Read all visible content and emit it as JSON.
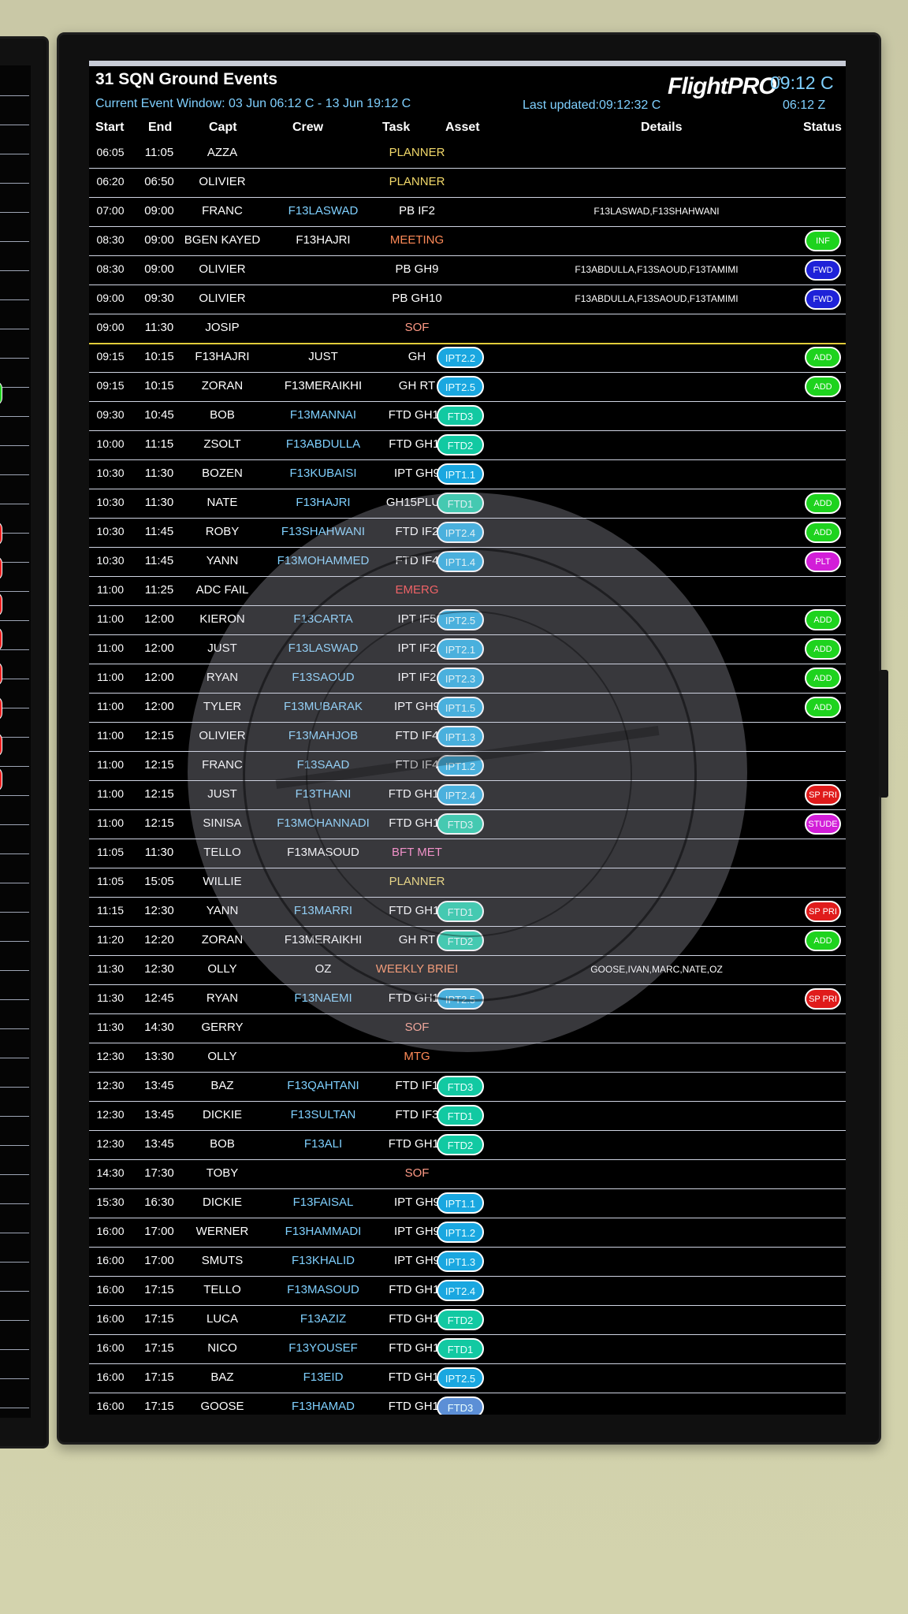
{
  "board": {
    "title": "31 SQN Ground Events",
    "event_window": "Current Event Window: 03 Jun 06:12 C - 13 Jun 19:12 C",
    "last_updated": "Last updated:09:12:32 C",
    "brand": "FlightPRO",
    "brand_sup": "°",
    "time_c": "09:12 C",
    "time_z": "06:12 Z"
  },
  "columns": [
    "Start",
    "End",
    "Capt",
    "Crew",
    "Task",
    "Asset",
    "Details",
    "Status"
  ],
  "rows": [
    {
      "start": "06:05",
      "end": "11:05",
      "capt": "AZZA",
      "crew": "",
      "task": "PLANNER",
      "task_color": "#f2d96a",
      "asset": "",
      "asset_color": "",
      "details": "",
      "status": "",
      "status_color": ""
    },
    {
      "start": "06:20",
      "end": "06:50",
      "capt": "OLIVIER",
      "crew": "",
      "task": "PLANNER",
      "task_color": "#f2d96a",
      "asset": "",
      "asset_color": "",
      "details": "",
      "status": "",
      "status_color": ""
    },
    {
      "start": "07:00",
      "end": "09:00",
      "capt": "FRANC",
      "crew": "F13LASWAD",
      "task": "PB IF2",
      "task_color": "#ffffff",
      "asset": "",
      "asset_color": "",
      "details": "F13LASWAD,F13SHAHWANI",
      "status": "",
      "status_color": ""
    },
    {
      "start": "08:30",
      "end": "09:00",
      "capt": "BGEN KAYED",
      "crew": "F13HAJRI",
      "crew_white": true,
      "task": "MEETING",
      "task_color": "#ff8a57",
      "asset": "",
      "asset_color": "",
      "details": "",
      "status": "INF",
      "status_color": "#1ed31e"
    },
    {
      "start": "08:30",
      "end": "09:00",
      "capt": "OLIVIER",
      "crew": "",
      "task": "PB GH9",
      "task_color": "#ffffff",
      "asset": "",
      "asset_color": "",
      "details": "F13ABDULLA,F13SAOUD,F13TAMIMI",
      "status": "FWD",
      "status_color": "#1e22d8"
    },
    {
      "start": "09:00",
      "end": "09:30",
      "capt": "OLIVIER",
      "crew": "",
      "task": "PB GH10",
      "task_color": "#ffffff",
      "asset": "",
      "asset_color": "",
      "details": "F13ABDULLA,F13SAOUD,F13TAMIMI",
      "status": "FWD",
      "status_color": "#1e22d8"
    },
    {
      "start": "09:00",
      "end": "11:30",
      "capt": "JOSIP",
      "crew": "",
      "task": "SOF",
      "task_color": "#ff9a86",
      "asset": "",
      "asset_color": "",
      "details": "",
      "status": "",
      "status_color": "",
      "sep": true
    },
    {
      "start": "09:15",
      "end": "10:15",
      "capt": "F13HAJRI",
      "crew": "JUST",
      "crew_white": true,
      "task": "GH",
      "task_color": "#ffffff",
      "asset": "IPT2.2",
      "asset_color": "#1aa7e0",
      "details": "",
      "status": "ADD",
      "status_color": "#1ed31e"
    },
    {
      "start": "09:15",
      "end": "10:15",
      "capt": "ZORAN",
      "crew": "F13MERAIKHI",
      "crew_white": true,
      "task": "GH RT",
      "task_color": "#ffffff",
      "asset": "IPT2.5",
      "asset_color": "#1aa7e0",
      "details": "",
      "status": "ADD",
      "status_color": "#1ed31e"
    },
    {
      "start": "09:30",
      "end": "10:45",
      "capt": "BOB",
      "crew": "F13MANNAI",
      "task": "FTD GH12",
      "task_color": "#ffffff",
      "asset": "FTD3",
      "asset_color": "#12c9a2",
      "details": "",
      "status": "",
      "status_color": ""
    },
    {
      "start": "10:00",
      "end": "11:15",
      "capt": "ZSOLT",
      "crew": "F13ABDULLA",
      "task": "FTD GH11",
      "task_color": "#ffffff",
      "asset": "FTD2",
      "asset_color": "#12c9a2",
      "details": "",
      "status": "",
      "status_color": ""
    },
    {
      "start": "10:30",
      "end": "11:30",
      "capt": "BOZEN",
      "crew": "F13KUBAISI",
      "task": "IPT GH9",
      "task_color": "#ffffff",
      "asset": "IPT1.1",
      "asset_color": "#1aa7e0",
      "details": "",
      "status": "",
      "status_color": ""
    },
    {
      "start": "10:30",
      "end": "11:30",
      "capt": "NATE",
      "crew": "F13HAJRI",
      "task": "GH15PLUS",
      "task_color": "#ffffff",
      "asset": "FTD1",
      "asset_color": "#12c9a2",
      "details": "",
      "status": "ADD",
      "status_color": "#1ed31e"
    },
    {
      "start": "10:30",
      "end": "11:45",
      "capt": "ROBY",
      "crew": "F13SHAHWANI",
      "task": "FTD IF2",
      "task_color": "#ffffff",
      "asset": "IPT2.4",
      "asset_color": "#1aa7e0",
      "details": "",
      "status": "ADD",
      "status_color": "#1ed31e"
    },
    {
      "start": "10:30",
      "end": "11:45",
      "capt": "YANN",
      "crew": "F13MOHAMMED",
      "task": "FTD IF4",
      "task_color": "#ffffff",
      "asset": "IPT1.4",
      "asset_color": "#1aa7e0",
      "details": "",
      "status": "PLT",
      "status_color": "#d21ed8"
    },
    {
      "start": "11:00",
      "end": "11:25",
      "capt": "ADC FAIL",
      "crew": "",
      "task": "EMERG",
      "task_color": "#ff3c3c",
      "asset": "",
      "asset_color": "",
      "details": "",
      "status": "",
      "status_color": ""
    },
    {
      "start": "11:00",
      "end": "12:00",
      "capt": "KIERON",
      "crew": "F13CARTA",
      "task": "IPT IF5",
      "task_color": "#ffffff",
      "asset": "IPT2.5",
      "asset_color": "#1aa7e0",
      "details": "",
      "status": "ADD",
      "status_color": "#1ed31e"
    },
    {
      "start": "11:00",
      "end": "12:00",
      "capt": "JUST",
      "crew": "F13LASWAD",
      "task": "IPT IF2",
      "task_color": "#ffffff",
      "asset": "IPT2.1",
      "asset_color": "#1aa7e0",
      "details": "",
      "status": "ADD",
      "status_color": "#1ed31e"
    },
    {
      "start": "11:00",
      "end": "12:00",
      "capt": "RYAN",
      "crew": "F13SAOUD",
      "task": "IPT IF2",
      "task_color": "#ffffff",
      "asset": "IPT2.3",
      "asset_color": "#1aa7e0",
      "details": "",
      "status": "ADD",
      "status_color": "#1ed31e"
    },
    {
      "start": "11:00",
      "end": "12:00",
      "capt": "TYLER",
      "crew": "F13MUBARAK",
      "task": "IPT GH9",
      "task_color": "#ffffff",
      "asset": "IPT1.5",
      "asset_color": "#1aa7e0",
      "details": "",
      "status": "ADD",
      "status_color": "#1ed31e"
    },
    {
      "start": "11:00",
      "end": "12:15",
      "capt": "OLIVIER",
      "crew": "F13MAHJOB",
      "task": "FTD IF4",
      "task_color": "#ffffff",
      "asset": "IPT1.3",
      "asset_color": "#1aa7e0",
      "details": "",
      "status": "",
      "status_color": ""
    },
    {
      "start": "11:00",
      "end": "12:15",
      "capt": "FRANC",
      "crew": "F13SAAD",
      "task": "FTD IF4",
      "task_color": "#ffffff",
      "asset": "IPT1.2",
      "asset_color": "#1aa7e0",
      "details": "",
      "status": "",
      "status_color": ""
    },
    {
      "start": "11:00",
      "end": "12:15",
      "capt": "JUST",
      "crew": "F13THANI",
      "task": "FTD GH12",
      "task_color": "#ffffff",
      "asset": "IPT2.4",
      "asset_color": "#1aa7e0",
      "details": "",
      "status": "SP PRI",
      "status_color": "#e01b1b"
    },
    {
      "start": "11:00",
      "end": "12:15",
      "capt": "SINISA",
      "crew": "F13MOHANNADI",
      "task": "FTD GH11",
      "task_color": "#ffffff",
      "asset": "FTD3",
      "asset_color": "#12c9a2",
      "details": "",
      "status": "STUDE",
      "status_color": "#d21ed8"
    },
    {
      "start": "11:05",
      "end": "11:30",
      "capt": "TELLO",
      "crew": "F13MASOUD",
      "crew_white": true,
      "task": "BFT MET",
      "task_color": "#ff7cc2",
      "asset": "",
      "asset_color": "",
      "details": "",
      "status": "",
      "status_color": ""
    },
    {
      "start": "11:05",
      "end": "15:05",
      "capt": "WILLIE",
      "crew": "",
      "task": "PLANNER",
      "task_color": "#f2d96a",
      "asset": "",
      "asset_color": "",
      "details": "",
      "status": "",
      "status_color": ""
    },
    {
      "start": "11:15",
      "end": "12:30",
      "capt": "YANN",
      "crew": "F13MARRI",
      "task": "FTD GH11",
      "task_color": "#ffffff",
      "asset": "FTD1",
      "asset_color": "#12c9a2",
      "details": "",
      "status": "SP PRI",
      "status_color": "#e01b1b"
    },
    {
      "start": "11:20",
      "end": "12:20",
      "capt": "ZORAN",
      "crew": "F13MERAIKHI",
      "crew_white": true,
      "task": "GH RT",
      "task_color": "#ffffff",
      "asset": "FTD2",
      "asset_color": "#12c9a2",
      "details": "",
      "status": "ADD",
      "status_color": "#1ed31e"
    },
    {
      "start": "11:30",
      "end": "12:30",
      "capt": "OLLY",
      "crew": "OZ",
      "crew_white": true,
      "task": "WEEKLY BRIEI",
      "task_color": "#ff8a57",
      "asset": "",
      "asset_color": "",
      "details": "GOOSE,IVAN,MARC,NATE,OZ",
      "status": "",
      "status_color": ""
    },
    {
      "start": "11:30",
      "end": "12:45",
      "capt": "RYAN",
      "crew": "F13NAEMI",
      "task": "FTD GH12",
      "task_color": "#ffffff",
      "asset": "IPT2.5",
      "asset_color": "#1aa7e0",
      "details": "",
      "status": "SP PRI",
      "status_color": "#e01b1b"
    },
    {
      "start": "11:30",
      "end": "14:30",
      "capt": "GERRY",
      "crew": "",
      "task": "SOF",
      "task_color": "#ff9a86",
      "asset": "",
      "asset_color": "",
      "details": "",
      "status": "",
      "status_color": ""
    },
    {
      "start": "12:30",
      "end": "13:30",
      "capt": "OLLY",
      "crew": "",
      "task": "MTG",
      "task_color": "#ff8a57",
      "asset": "",
      "asset_color": "",
      "details": "",
      "status": "",
      "status_color": ""
    },
    {
      "start": "12:30",
      "end": "13:45",
      "capt": "BAZ",
      "crew": "F13QAHTANI",
      "task": "FTD IF1",
      "task_color": "#ffffff",
      "asset": "FTD3",
      "asset_color": "#12c9a2",
      "details": "",
      "status": "",
      "status_color": ""
    },
    {
      "start": "12:30",
      "end": "13:45",
      "capt": "DICKIE",
      "crew": "F13SULTAN",
      "task": "FTD IF3",
      "task_color": "#ffffff",
      "asset": "FTD1",
      "asset_color": "#12c9a2",
      "details": "",
      "status": "",
      "status_color": ""
    },
    {
      "start": "12:30",
      "end": "13:45",
      "capt": "BOB",
      "crew": "F13ALI",
      "task": "FTD GH13",
      "task_color": "#ffffff",
      "asset": "FTD2",
      "asset_color": "#12c9a2",
      "details": "",
      "status": "",
      "status_color": ""
    },
    {
      "start": "14:30",
      "end": "17:30",
      "capt": "TOBY",
      "crew": "",
      "task": "SOF",
      "task_color": "#ff9a86",
      "asset": "",
      "asset_color": "",
      "details": "",
      "status": "",
      "status_color": ""
    },
    {
      "start": "15:30",
      "end": "16:30",
      "capt": "DICKIE",
      "crew": "F13FAISAL",
      "task": "IPT GH9",
      "task_color": "#ffffff",
      "asset": "IPT1.1",
      "asset_color": "#1aa7e0",
      "details": "",
      "status": "",
      "status_color": ""
    },
    {
      "start": "16:00",
      "end": "17:00",
      "capt": "WERNER",
      "crew": "F13HAMMADI",
      "task": "IPT GH9",
      "task_color": "#ffffff",
      "asset": "IPT1.2",
      "asset_color": "#1aa7e0",
      "details": "",
      "status": "",
      "status_color": ""
    },
    {
      "start": "16:00",
      "end": "17:00",
      "capt": "SMUTS",
      "crew": "F13KHALID",
      "task": "IPT GH9",
      "task_color": "#ffffff",
      "asset": "IPT1.3",
      "asset_color": "#1aa7e0",
      "details": "",
      "status": "",
      "status_color": ""
    },
    {
      "start": "16:00",
      "end": "17:15",
      "capt": "TELLO",
      "crew": "F13MASOUD",
      "task": "FTD GH11",
      "task_color": "#ffffff",
      "asset": "IPT2.4",
      "asset_color": "#1aa7e0",
      "details": "",
      "status": "",
      "status_color": ""
    },
    {
      "start": "16:00",
      "end": "17:15",
      "capt": "LUCA",
      "crew": "F13AZIZ",
      "task": "FTD GH11",
      "task_color": "#ffffff",
      "asset": "FTD2",
      "asset_color": "#12c9a2",
      "details": "",
      "status": "",
      "status_color": ""
    },
    {
      "start": "16:00",
      "end": "17:15",
      "capt": "NICO",
      "crew": "F13YOUSEF",
      "task": "FTD GH11",
      "task_color": "#ffffff",
      "asset": "FTD1",
      "asset_color": "#12c9a2",
      "details": "",
      "status": "",
      "status_color": ""
    },
    {
      "start": "16:00",
      "end": "17:15",
      "capt": "BAZ",
      "crew": "F13EID",
      "task": "FTD GH12",
      "task_color": "#ffffff",
      "asset": "IPT2.5",
      "asset_color": "#1aa7e0",
      "details": "",
      "status": "",
      "status_color": ""
    },
    {
      "start": "16:00",
      "end": "17:15",
      "capt": "GOOSE",
      "crew": "F13HAMAD",
      "task": "FTD GH12",
      "task_color": "#ffffff",
      "asset": "FTD3",
      "asset_color": "#5c8fd6",
      "details": "",
      "status": "",
      "status_color": ""
    }
  ]
}
